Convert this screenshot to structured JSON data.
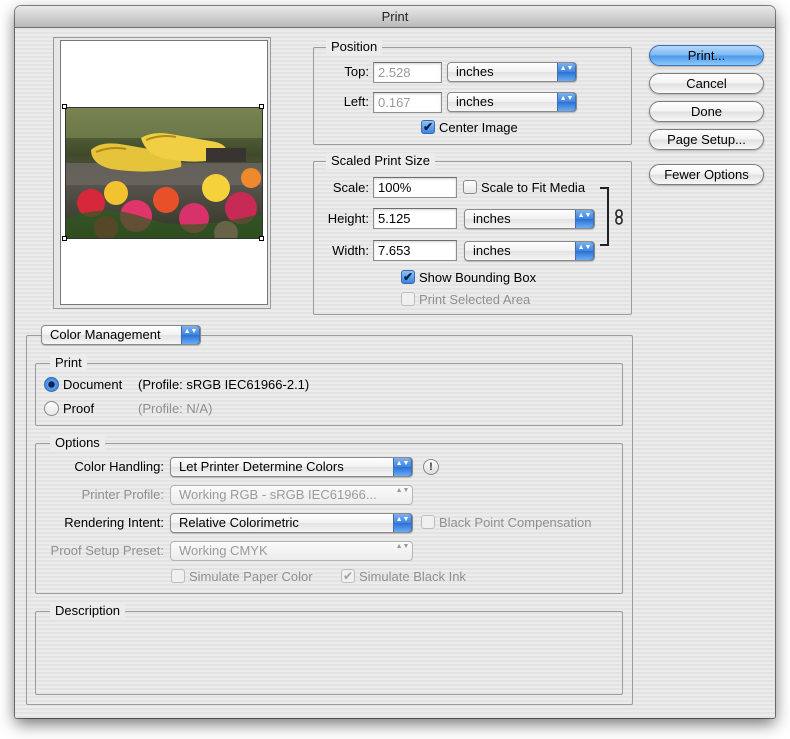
{
  "window": {
    "title": "Print"
  },
  "buttons": {
    "print": "Print...",
    "cancel": "Cancel",
    "done": "Done",
    "page_setup": "Page Setup...",
    "fewer_options": "Fewer Options"
  },
  "position": {
    "legend": "Position",
    "top_label": "Top:",
    "top_value": "2.528",
    "top_unit": "inches",
    "left_label": "Left:",
    "left_value": "0.167",
    "left_unit": "inches",
    "center_image_label": "Center Image",
    "center_image_checked": true
  },
  "scaled_print_size": {
    "legend": "Scaled Print Size",
    "scale_label": "Scale:",
    "scale_value": "100%",
    "scale_to_fit_label": "Scale to Fit Media",
    "height_label": "Height:",
    "height_value": "5.125",
    "height_unit": "inches",
    "width_label": "Width:",
    "width_value": "7.653",
    "width_unit": "inches",
    "show_bounding_box_label": "Show Bounding Box",
    "print_selected_area_label": "Print Selected Area"
  },
  "color_management": {
    "section_popup": "Color Management",
    "print_group": {
      "legend": "Print",
      "document_label": "Document",
      "document_profile": "(Profile: sRGB IEC61966-2.1)",
      "proof_label": "Proof",
      "proof_profile": "(Profile: N/A)",
      "selected": "Document"
    },
    "options_group": {
      "legend": "Options",
      "color_handling_label": "Color Handling:",
      "color_handling_value": "Let Printer Determine Colors",
      "printer_profile_label": "Printer Profile:",
      "printer_profile_value": "Working RGB - sRGB IEC61966...",
      "rendering_intent_label": "Rendering Intent:",
      "rendering_intent_value": "Relative Colorimetric",
      "black_point_label": "Black Point Compensation",
      "proof_setup_label": "Proof Setup Preset:",
      "proof_setup_value": "Working CMYK",
      "simulate_paper_label": "Simulate Paper Color",
      "simulate_black_label": "Simulate Black Ink"
    },
    "description_group": {
      "legend": "Description"
    }
  },
  "icons": {
    "info": "!",
    "checkmark": "✔",
    "popup_arrows": "▲▼"
  }
}
